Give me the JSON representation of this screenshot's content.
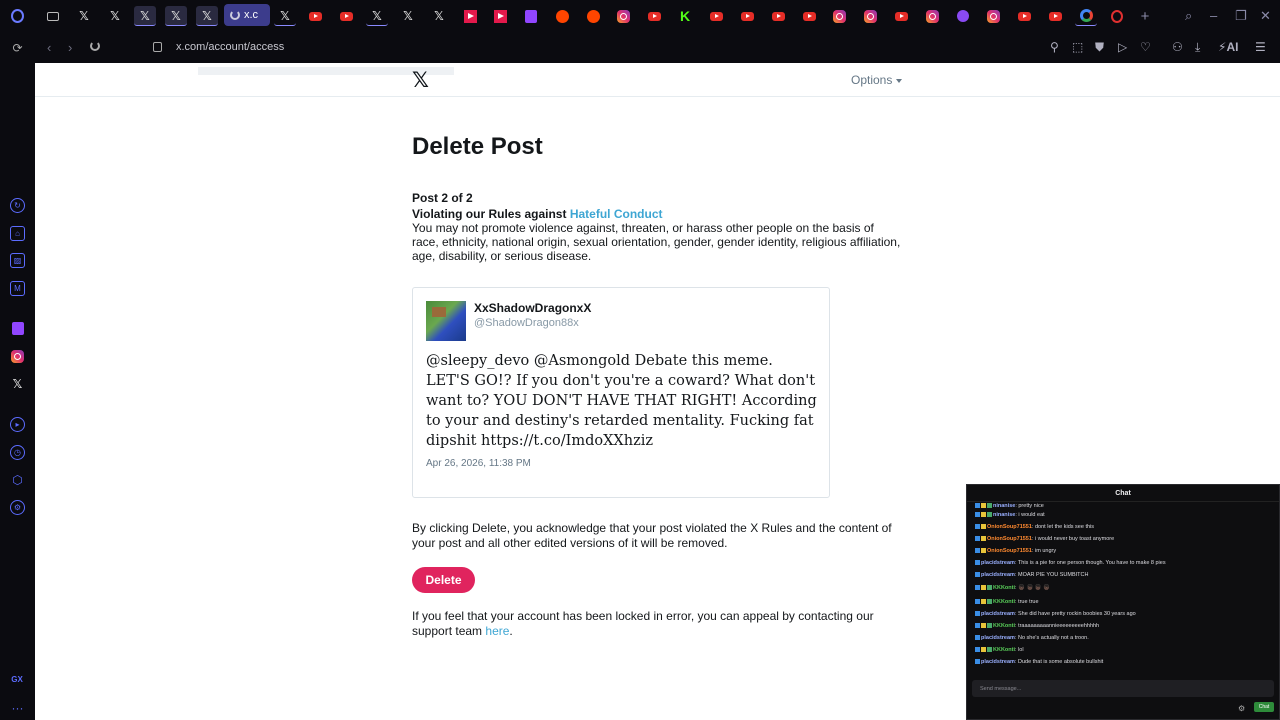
{
  "browser": {
    "active_tab_label": "x.c",
    "url": "x.com/account/access",
    "ai_label": "AI",
    "gx_label": "GX"
  },
  "page": {
    "options_label": "Options",
    "title": "Delete Post",
    "post_count": "Post 2 of 2",
    "rule_prefix": "Violating our Rules against",
    "rule_link": "Hateful Conduct",
    "rule_description": "You may not promote violence against, threaten, or harass other people on the basis of race, ethnicity, national origin, sexual orientation, gender, gender identity, religious affiliation, age, disability, or serious disease.",
    "tweet": {
      "display_name": "XxShadowDragonxX",
      "handle": "@ShadowDragon88x",
      "text": "@sleepy_devo @Asmongold Debate this meme. LET'S GO!? If you don't you're a coward? What don't want to? YOU DON'T HAVE THAT RIGHT! According to your and destiny's retarded mentality. Fucking fat dipshit https://t.co/ImdoXXhziz",
      "date": "Apr 26, 2026, 11:38 PM"
    },
    "acknowledgement": "By clicking Delete, you acknowledge that your post violated the X Rules and the content of your post and all other edited versions of it will be removed.",
    "delete_label": "Delete",
    "appeal_text": "If you feel that your account has been locked in error, you can appeal by contacting our support team",
    "appeal_link": "here",
    "appeal_end": "."
  },
  "chat": {
    "header": "Chat",
    "input_placeholder": "Send message...",
    "send_label": "Chat",
    "messages": [
      {
        "user": "ninanise",
        "text": "pretty nice"
      },
      {
        "user": "ninanise",
        "text": "i would eat"
      },
      {
        "user": "OnionSoup71551",
        "text": "dont let the kids see this"
      },
      {
        "user": "OnionSoup71551",
        "text": "i would never buy toast anymore"
      },
      {
        "user": "OnionSoup71551",
        "text": "im ungry"
      },
      {
        "user": "placidstream",
        "text": "This is a pie for one person though. You have to make 8 pies"
      },
      {
        "user": "placidstream",
        "text": "MOAR PIE YOU SUMBITCH"
      },
      {
        "user": "KKKonti",
        "text": "👦🏿 👦🏿 👦🏿 👦🏿"
      },
      {
        "user": "KKKonti",
        "text": "true true"
      },
      {
        "user": "placidstream",
        "text": "She did have pretty rockin boobies 30 years ago"
      },
      {
        "user": "KKKonti",
        "text": "traaaaaaaaannieeeeeeeeehhhhh"
      },
      {
        "user": "placidstream",
        "text": "No she's actually not a troon."
      },
      {
        "user": "KKKonti",
        "text": "lol"
      },
      {
        "user": "placidstream",
        "text": "Dude that is some absolute bullshit"
      }
    ]
  }
}
